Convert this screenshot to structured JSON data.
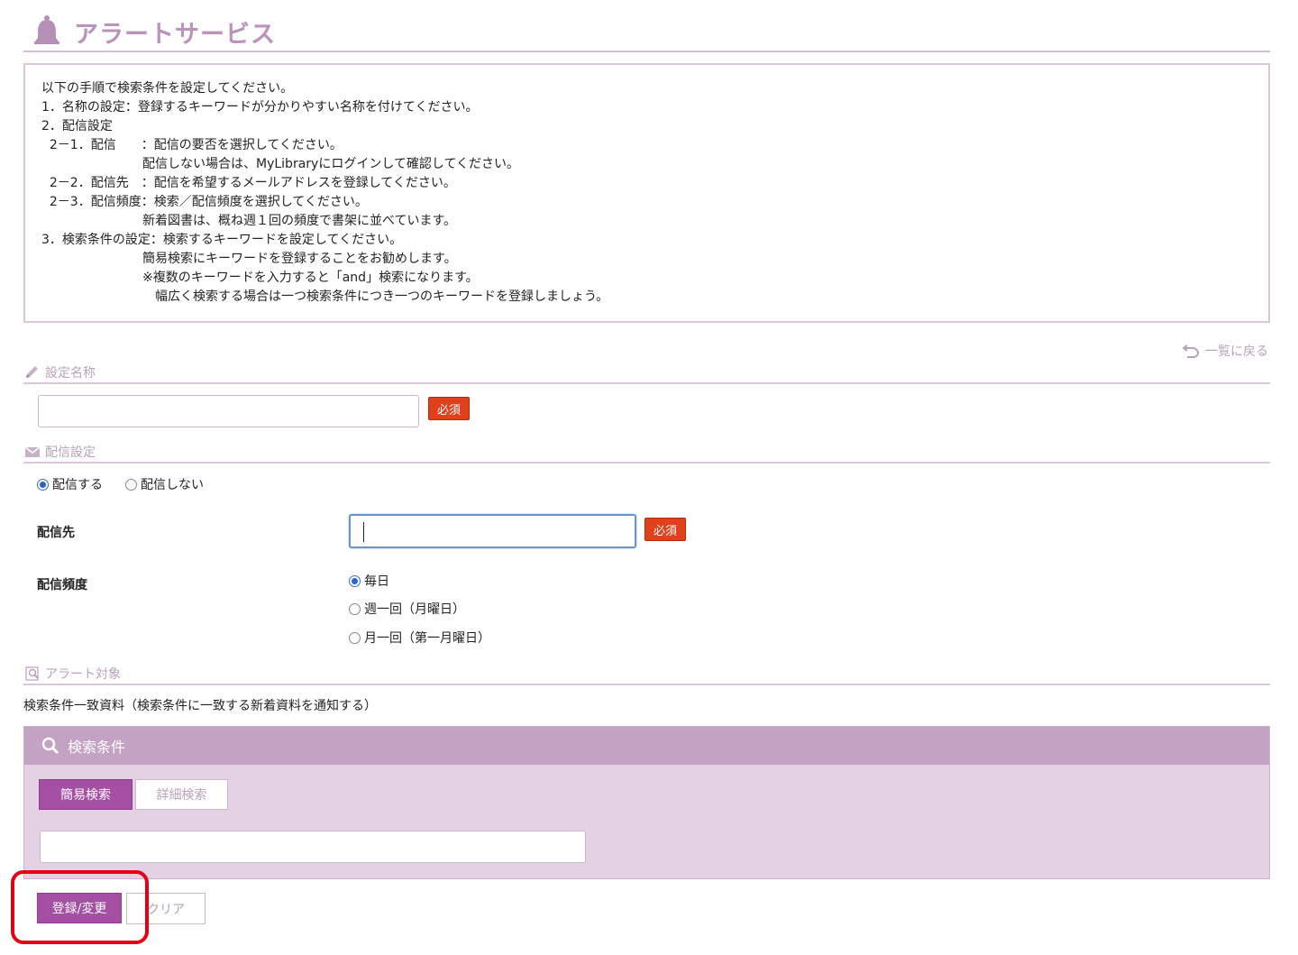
{
  "page": {
    "title": "アラートサービス",
    "icon": "bell-icon"
  },
  "instructions": {
    "lines": [
      "以下の手順で検索条件を設定してください。",
      "1．名称の設定：登録するキーワードが分かりやすい名称を付けてください。",
      "2．配信設定",
      "  2－1．配信　　：配信の要否を選択してください。",
      "　　　　　　　　配信しない場合は、MyLibraryにログインして確認してください。",
      "  2－2．配信先　：配信を希望するメールアドレスを登録してください。",
      "  2－3．配信頻度：検索／配信頻度を選択してください。",
      "　　　　　　　　新着図書は、概ね週１回の頻度で書架に並べています。",
      "3．検索条件の設定：検索するキーワードを設定してください。",
      "　　　　　　　　簡易検索にキーワードを登録することをお勧めします。",
      "　　　　　　　　※複数のキーワードを入力すると「and」検索になります。",
      "　　　　　　　　　幅広く検索する場合は一つ検索条件につき一つのキーワードを登録しましょう。"
    ]
  },
  "back_link": {
    "label": "一覧に戻る"
  },
  "name_section": {
    "heading": "設定名称",
    "input_value": "",
    "required_label": "必須"
  },
  "delivery_section": {
    "heading": "配信設定",
    "options": [
      {
        "label": "配信する",
        "checked": true
      },
      {
        "label": "配信しない",
        "checked": false
      }
    ],
    "destination": {
      "label": "配信先",
      "input_value": "",
      "required_label": "必須"
    },
    "frequency": {
      "label": "配信頻度",
      "options": [
        {
          "label": "毎日",
          "checked": true
        },
        {
          "label": "週一回（月曜日）",
          "checked": false
        },
        {
          "label": "月一回（第一月曜日）",
          "checked": false
        }
      ]
    }
  },
  "alert_section": {
    "heading": "アラート対象",
    "description": "検索条件一致資料（検索条件に一致する新着資料を通知する）",
    "panel": {
      "title": "検索条件",
      "tabs": [
        {
          "label": "簡易検索",
          "active": true
        },
        {
          "label": "詳細検索",
          "active": false
        }
      ],
      "input_value": ""
    }
  },
  "buttons": {
    "register": "登録/変更",
    "clear": "クリア"
  },
  "colors": {
    "accent": "#a44ea4",
    "title": "#bb92bb",
    "required": "#e0401c",
    "highlight": "#e60012",
    "panel_bg": "#e4d2e4",
    "panel_head": "#c4a2c4"
  }
}
